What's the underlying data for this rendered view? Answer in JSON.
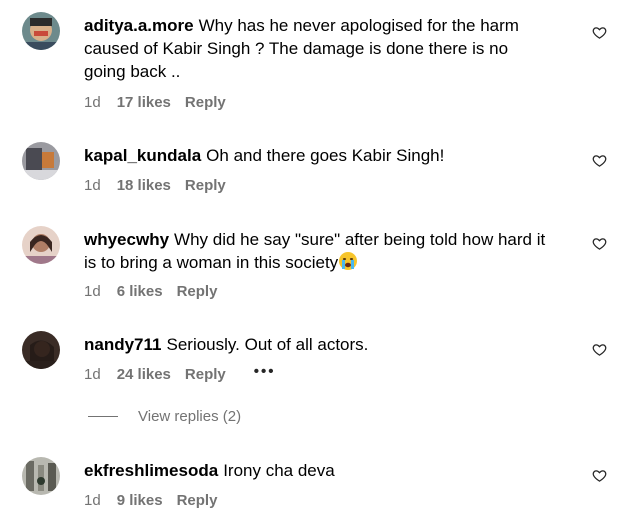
{
  "comments": [
    {
      "username": "aditya.a.more",
      "text": "Why has he never apologised for the harm caused of Kabir Singh ? The damage is done there is no going back ..",
      "age": "1d",
      "likes": "17 likes",
      "reply": "Reply"
    },
    {
      "username": "kapal_kundala",
      "text": "Oh and there goes Kabir Singh!",
      "age": "1d",
      "likes": "18 likes",
      "reply": "Reply"
    },
    {
      "username": "whyecwhy",
      "text": "Why did he say \"sure\" after being told how hard it is to bring a woman in this society",
      "age": "1d",
      "likes": "6 likes",
      "reply": "Reply",
      "emoji": "crying-face-emoji"
    },
    {
      "username": "nandy711",
      "text": "Seriously. Out of all actors.",
      "age": "1d",
      "likes": "24 likes",
      "reply": "Reply",
      "more": "•••"
    },
    {
      "username": "ekfreshlimesoda",
      "text": "Irony cha deva",
      "age": "1d",
      "likes": "9 likes",
      "reply": "Reply"
    }
  ],
  "view_replies": "View replies (2)",
  "icons": {
    "like": "heart-outline-icon",
    "options": "more-options-icon"
  },
  "colors": {
    "meta": "#737373",
    "text": "#000000"
  }
}
